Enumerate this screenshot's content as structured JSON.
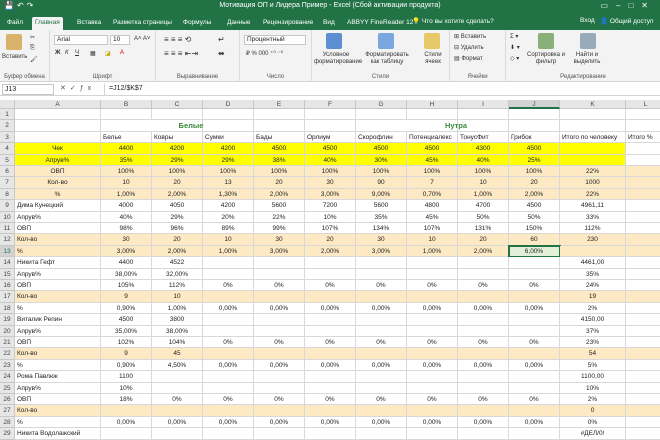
{
  "window": {
    "title": "Мотивация ОП и Лидера Пример - Excel (Сбой активации продукта)"
  },
  "tabs": [
    {
      "label": "Файл",
      "active": false
    },
    {
      "label": "Главная",
      "active": true
    },
    {
      "label": "Вставка",
      "active": false
    },
    {
      "label": "Разметка страницы",
      "active": false
    },
    {
      "label": "Формулы",
      "active": false
    },
    {
      "label": "Данные",
      "active": false
    },
    {
      "label": "Рецензирование",
      "active": false
    },
    {
      "label": "Вид",
      "active": false
    },
    {
      "label": "ABBYY FineReader 12",
      "active": false
    }
  ],
  "tellme": "Что вы хотите сделать?",
  "signin": "Вход",
  "share": "Общий доступ",
  "ribbon": {
    "paste": "Вставить",
    "groups": {
      "clipboard": "Буфер обмена",
      "font": "Шрифт",
      "alignment": "Выравнивание",
      "number": "Число",
      "styles": "Стили",
      "cells": "Ячейки",
      "editing": "Редактирование"
    },
    "font_name": "Arial",
    "font_size": "10",
    "bold": "Ж",
    "italic": "К",
    "underline": "Ч",
    "number_format": "Процентный",
    "cond_format": "Условное форматирование",
    "format_table": "Форматировать как таблицу",
    "cell_styles": "Стили ячеек",
    "insert": "Вставить",
    "delete": "Удалить",
    "format": "Формат",
    "sort_filter": "Сортировка и фильтр",
    "find_select": "Найти и выделить"
  },
  "formula_bar": {
    "name_box": "J13",
    "formula": "=J12/$K$7"
  },
  "columns": [
    "A",
    "B",
    "C",
    "D",
    "E",
    "F",
    "G",
    "H",
    "I",
    "J",
    "K",
    "L"
  ],
  "selected_column": "J",
  "rows": [
    "1",
    "2",
    "3",
    "4",
    "5",
    "6",
    "7",
    "8",
    "9",
    "10",
    "11",
    "12",
    "13",
    "14",
    "15",
    "16",
    "17",
    "18",
    "19",
    "20",
    "21",
    "22",
    "23",
    "24",
    "25",
    "26",
    "27",
    "28",
    "29",
    "30",
    "31"
  ],
  "selected_row": "13",
  "cells": {
    "2": {
      "B": "Белые",
      "G": "Нутра"
    },
    "3": {
      "B": "Белье",
      "C": "Ковры",
      "D": "Сумки",
      "E": "Бады",
      "F": "Орлиум",
      "G": "Скорофлин",
      "H": "Потенциалекс",
      "I": "ТонусФит",
      "J": "Грибок",
      "K": "Итого по человеку",
      "L": "Итого %"
    },
    "4": {
      "A": "Чек",
      "B": "4400",
      "C": "4200",
      "D": "4200",
      "E": "4500",
      "F": "4500",
      "G": "4500",
      "H": "4500",
      "I": "4300",
      "J": "4500"
    },
    "5": {
      "A": "Апрув%",
      "B": "35%",
      "C": "29%",
      "D": "29%",
      "E": "38%",
      "F": "40%",
      "G": "30%",
      "H": "45%",
      "I": "40%",
      "J": "25%"
    },
    "6": {
      "A": "ОВП",
      "B": "100%",
      "C": "100%",
      "D": "100%",
      "E": "100%",
      "F": "100%",
      "G": "100%",
      "H": "100%",
      "I": "100%",
      "J": "100%",
      "K": "22%"
    },
    "7": {
      "A": "Кол-во",
      "B": "10",
      "C": "20",
      "D": "13",
      "E": "20",
      "F": "30",
      "G": "90",
      "H": "7",
      "I": "10",
      "J": "20",
      "K": "1000"
    },
    "8": {
      "A": "%",
      "B": "1,00%",
      "C": "2,00%",
      "D": "1,30%",
      "E": "2,00%",
      "F": "3,00%",
      "G": "9,00%",
      "H": "0,70%",
      "I": "1,00%",
      "J": "2,00%",
      "K": "22%"
    },
    "9": {
      "A": "Дима Кунецкий",
      "B": "4000",
      "C": "4050",
      "D": "4200",
      "E": "5600",
      "F": "7200",
      "G": "5600",
      "H": "4800",
      "I": "4700",
      "J": "4500",
      "K": "4961,11"
    },
    "10": {
      "A": "Апрув%",
      "B": "40%",
      "C": "29%",
      "D": "20%",
      "E": "22%",
      "F": "10%",
      "G": "35%",
      "H": "45%",
      "I": "50%",
      "J": "50%",
      "K": "33%"
    },
    "11": {
      "A": "ОВП",
      "B": "98%",
      "C": "96%",
      "D": "89%",
      "E": "99%",
      "F": "107%",
      "G": "134%",
      "H": "107%",
      "I": "131%",
      "J": "150%",
      "K": "112%"
    },
    "12": {
      "A": "Кол-во",
      "B": "30",
      "C": "20",
      "D": "10",
      "E": "30",
      "F": "20",
      "G": "30",
      "H": "10",
      "I": "20",
      "J": "60",
      "K": "230"
    },
    "13": {
      "A": "%",
      "B": "3,00%",
      "C": "2,00%",
      "D": "1,00%",
      "E": "3,00%",
      "F": "2,00%",
      "G": "3,00%",
      "H": "1,00%",
      "I": "2,00%",
      "J": "6,00%"
    },
    "14": {
      "A": "Никита Гефт",
      "B": "4400",
      "C": "4522",
      "K": "4461,00"
    },
    "15": {
      "A": "Апрув%",
      "B": "38,00%",
      "C": "32,00%",
      "K": "35%"
    },
    "16": {
      "A": "ОВП",
      "B": "105%",
      "C": "112%",
      "D": "0%",
      "E": "0%",
      "F": "0%",
      "G": "0%",
      "H": "0%",
      "I": "0%",
      "J": "0%",
      "K": "24%"
    },
    "17": {
      "A": "Кол-во",
      "B": "9",
      "C": "10",
      "K": "19"
    },
    "18": {
      "A": "%",
      "B": "0,90%",
      "C": "1,00%",
      "D": "0,00%",
      "E": "0,00%",
      "F": "0,00%",
      "G": "0,00%",
      "H": "0,00%",
      "I": "0,00%",
      "J": "0,00%",
      "K": "2%"
    },
    "19": {
      "A": "Виталик Репин",
      "B": "4500",
      "C": "3800",
      "K": "4150,00"
    },
    "20": {
      "A": "Апрув%",
      "B": "35,00%",
      "C": "38,00%",
      "K": "37%"
    },
    "21": {
      "A": "ОВП",
      "B": "102%",
      "C": "104%",
      "D": "0%",
      "E": "0%",
      "F": "0%",
      "G": "0%",
      "H": "0%",
      "I": "0%",
      "J": "0%",
      "K": "23%"
    },
    "22": {
      "A": "Кол-во",
      "B": "9",
      "C": "45",
      "K": "54"
    },
    "23": {
      "A": "%",
      "B": "0,90%",
      "C": "4,50%",
      "D": "0,00%",
      "E": "0,00%",
      "F": "0,00%",
      "G": "0,00%",
      "H": "0,00%",
      "I": "0,00%",
      "J": "0,00%",
      "K": "5%"
    },
    "24": {
      "A": "Рома Павлюк",
      "B": "1100",
      "K": "1100,00"
    },
    "25": {
      "A": "Апрув%",
      "B": "10%",
      "K": "10%"
    },
    "26": {
      "A": "ОВП",
      "B": "18%",
      "C": "0%",
      "D": "0%",
      "E": "0%",
      "F": "0%",
      "G": "0%",
      "H": "0%",
      "I": "0%",
      "J": "0%",
      "K": "2%"
    },
    "27": {
      "A": "Кол-во",
      "K": "0"
    },
    "28": {
      "A": "%",
      "B": "0,00%",
      "C": "0,00%",
      "D": "0,00%",
      "E": "0,00%",
      "F": "0,00%",
      "G": "0,00%",
      "H": "0,00%",
      "I": "0,00%",
      "J": "0,00%",
      "K": "0%"
    },
    "29": {
      "A": "Никита Водолажский",
      "K": "#ДЕЛ/0!"
    },
    "30": {
      "A": "Апрув%",
      "K": "#ДЕЛ/0!"
    },
    "31": {
      "A": "ОВП",
      "B": "0%",
      "C": "0%",
      "D": "0%",
      "E": "0%",
      "F": "0%",
      "G": "0%",
      "H": "0%",
      "I": "0%",
      "J": "0%",
      "K": "0%"
    }
  },
  "colors": {
    "excel_green": "#217346",
    "yellow": "#ffff00",
    "peach": "#fde9c4",
    "header_green": "#3a8a3a"
  }
}
